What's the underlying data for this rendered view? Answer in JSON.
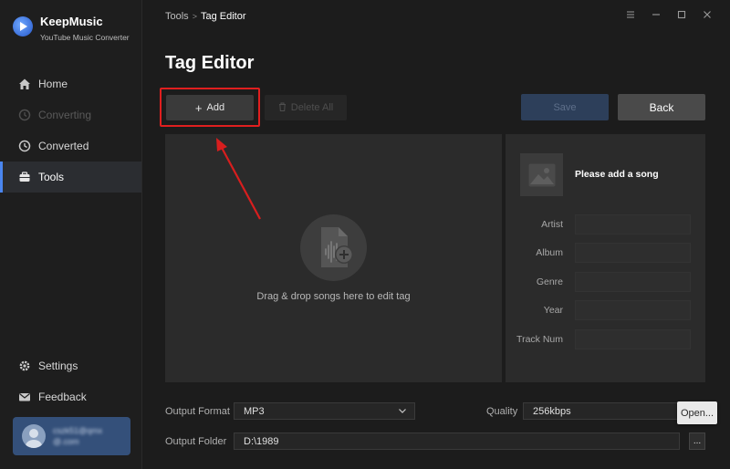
{
  "app": {
    "name": "KeepMusic",
    "subtitle": "YouTube Music Converter"
  },
  "sidebar": {
    "items": [
      {
        "label": "Home",
        "icon": "home-icon",
        "state": "normal"
      },
      {
        "label": "Converting",
        "icon": "clock-icon",
        "state": "disabled"
      },
      {
        "label": "Converted",
        "icon": "history-icon",
        "state": "normal"
      },
      {
        "label": "Tools",
        "icon": "toolbox-icon",
        "state": "active"
      }
    ],
    "bottom_items": [
      {
        "label": "Settings",
        "icon": "gear-icon"
      },
      {
        "label": "Feedback",
        "icon": "mail-icon"
      }
    ],
    "user": {
      "name_blurred": "cszk51@qmx",
      "email_blurred": "@.com"
    }
  },
  "header": {
    "breadcrumb_root": "Tools",
    "breadcrumb_sep": ">",
    "breadcrumb_current": "Tag Editor",
    "page_title": "Tag Editor"
  },
  "toolbar": {
    "add_label": "Add",
    "delete_all_label": "Delete All",
    "save_label": "Save",
    "back_label": "Back"
  },
  "dropzone": {
    "text": "Drag & drop songs here to edit tag"
  },
  "tag_panel": {
    "title": "Please add a song",
    "fields": [
      {
        "label": "Artist",
        "value": ""
      },
      {
        "label": "Album",
        "value": ""
      },
      {
        "label": "Genre",
        "value": ""
      },
      {
        "label": "Year",
        "value": ""
      },
      {
        "label": "Track Num",
        "value": ""
      }
    ]
  },
  "settings": {
    "output_format_label": "Output Format",
    "output_format_value": "MP3",
    "quality_label": "Quality",
    "quality_value": "256kbps",
    "output_folder_label": "Output Folder",
    "output_folder_value": "D:\\1989",
    "folder_button": "...",
    "tooltip": "Open..."
  },
  "colors": {
    "accent": "#4a86f0",
    "highlight": "#e01f1f",
    "background": "#1c1c1c",
    "panel": "#2b2b2b"
  }
}
